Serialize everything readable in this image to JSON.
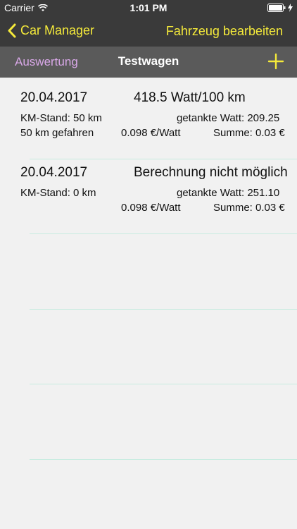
{
  "status": {
    "carrier": "Carrier",
    "time": "1:01 PM"
  },
  "nav": {
    "back_label": "Car Manager",
    "edit_label": "Fahrzeug bearbeiten"
  },
  "subnav": {
    "left_label": "Auswertung",
    "title": "Testwagen"
  },
  "colors": {
    "accent": "#f5ea3a",
    "link": "#d9a8e8",
    "bar": "#3a3a3a",
    "subbar": "#5a5a5a"
  },
  "entries": [
    {
      "date": "20.04.2017",
      "consumption": "418.5 Watt/100 km",
      "km_stand": "KM-Stand: 50 km",
      "driven": "50 km gefahren",
      "tanked": "getankte Watt: 209.25",
      "price": "0.098 €/Watt",
      "sum": "Summe: 0.03 €"
    },
    {
      "date": "20.04.2017",
      "consumption": "Berechnung nicht möglich",
      "km_stand": "KM-Stand: 0 km",
      "driven": "",
      "tanked": "getankte Watt: 251.10",
      "price": "0.098 €/Watt",
      "sum": "Summe: 0.03 €"
    }
  ]
}
